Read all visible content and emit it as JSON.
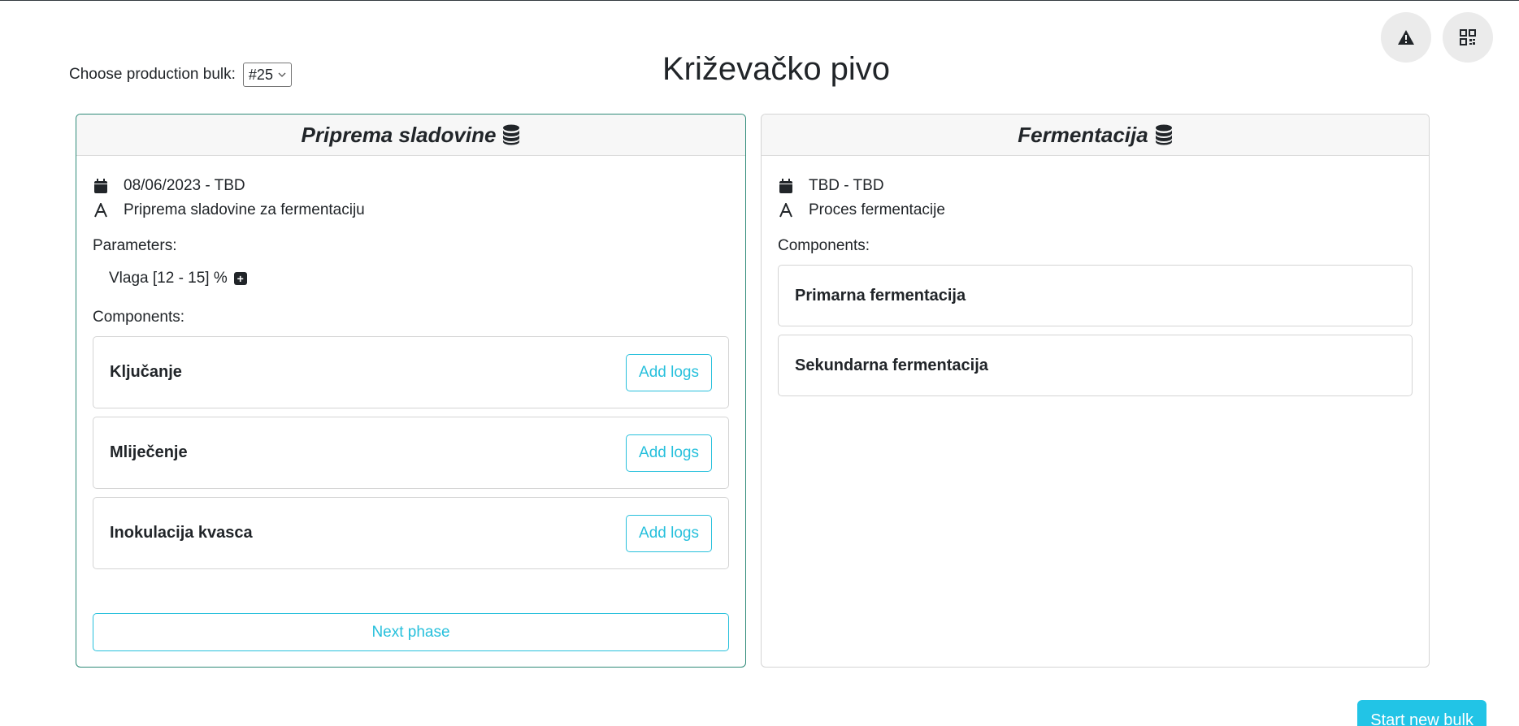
{
  "header": {
    "title": "Križevačko pivo",
    "bulk_label": "Choose production bulk:",
    "bulk_selected": "#25"
  },
  "actions": {
    "alert_icon": "warning-icon",
    "qr_icon": "qr-code-icon",
    "start_new_bulk": "Start new bulk"
  },
  "phases": [
    {
      "title": "Priprema sladovine",
      "dates": "08/06/2023 - TBD",
      "description": "Priprema sladovine za fermentaciju",
      "parameters_label": "Parameters:",
      "parameter": "Vlaga [12 - 15] %",
      "components_label": "Components:",
      "components": [
        {
          "name": "Ključanje",
          "action": "Add logs"
        },
        {
          "name": "Mliječenje",
          "action": "Add logs"
        },
        {
          "name": "Inokulacija kvasca",
          "action": "Add logs"
        }
      ],
      "next_label": "Next phase"
    },
    {
      "title": "Fermentacija",
      "dates": "TBD - TBD",
      "description": "Proces fermentacije",
      "components_label": "Components:",
      "components": [
        {
          "name": "Primarna fermentacija"
        },
        {
          "name": "Sekundarna fermentacija"
        }
      ]
    }
  ],
  "colors": {
    "accent": "#27c0dc",
    "active_border": "#2e8a78",
    "primary_button": "#22c4e6"
  }
}
